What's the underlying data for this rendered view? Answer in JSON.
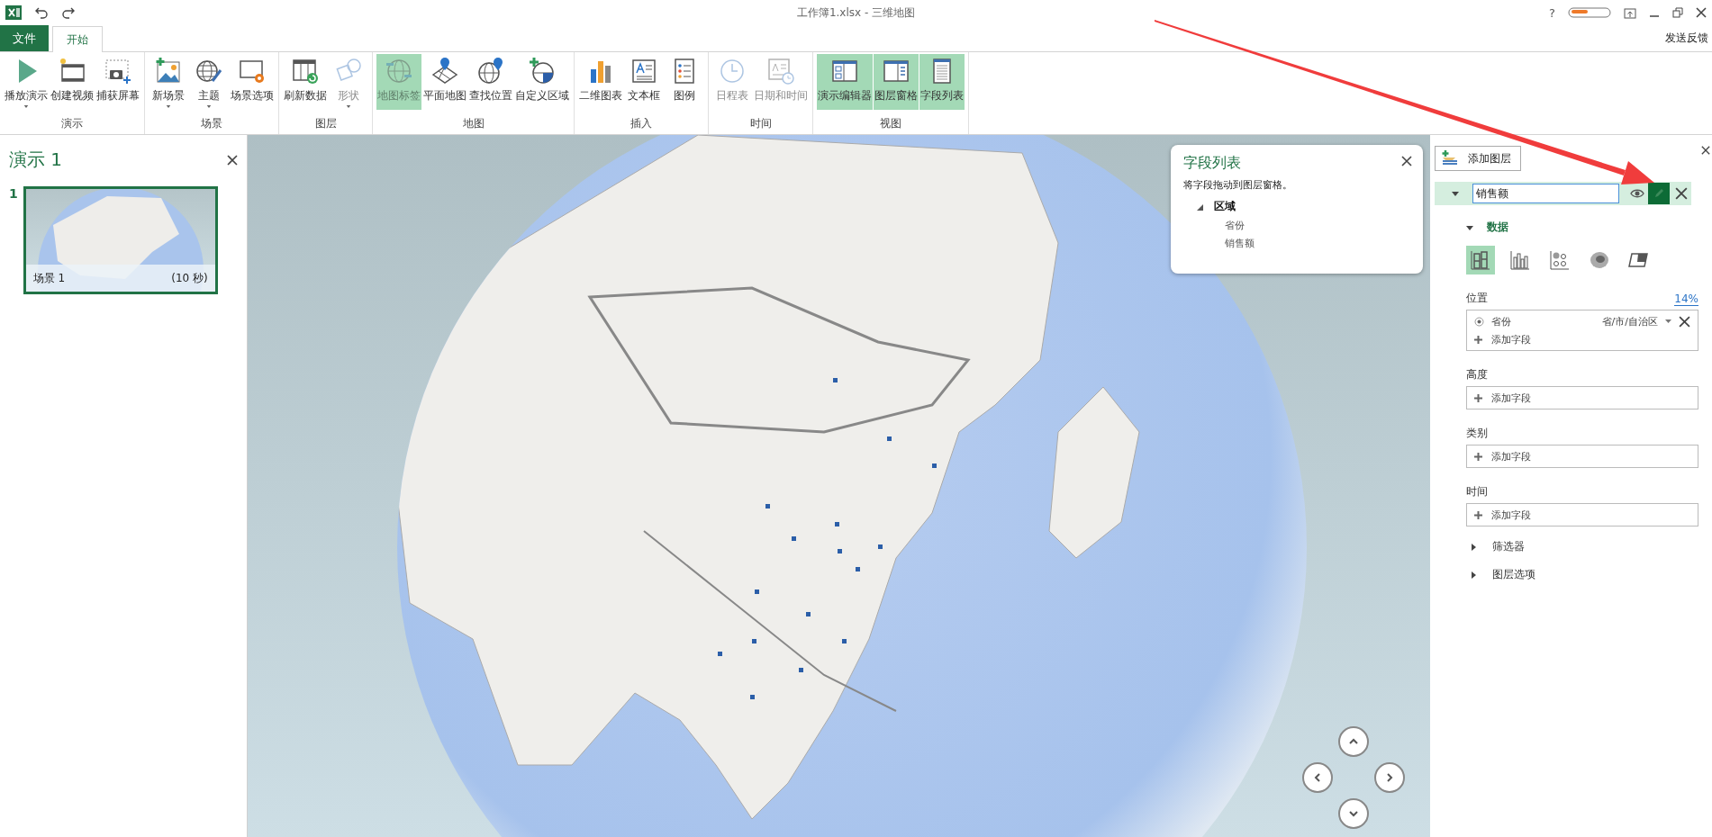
{
  "window": {
    "title": "工作簿1.xlsx - 三维地图",
    "help": "?"
  },
  "ribbon_tabs": [
    {
      "label": "文件",
      "kind": "file",
      "selected": false
    },
    {
      "label": "开始",
      "kind": "tab",
      "selected": true
    }
  ],
  "feedback": "发送反馈",
  "ribbon_groups": [
    {
      "label": "演示",
      "buttons": [
        {
          "label": "播放演示",
          "kind": "play",
          "dropdown": true,
          "selected": false,
          "disabled": false
        },
        {
          "label": "创建视频",
          "kind": "video",
          "dropdown": false,
          "selected": false,
          "disabled": false
        },
        {
          "label": "捕获屏幕",
          "kind": "capture",
          "dropdown": false,
          "selected": false,
          "disabled": false
        }
      ]
    },
    {
      "label": "场景",
      "buttons": [
        {
          "label": "新场景",
          "kind": "new-scene",
          "dropdown": true,
          "selected": false,
          "disabled": false
        },
        {
          "label": "主题",
          "kind": "theme",
          "dropdown": true,
          "selected": false,
          "disabled": false
        },
        {
          "label": "场景选项",
          "kind": "scene-options",
          "dropdown": false,
          "selected": false,
          "disabled": false
        }
      ]
    },
    {
      "label": "图层",
      "buttons": [
        {
          "label": "刷新数据",
          "kind": "refresh",
          "dropdown": false,
          "selected": false,
          "disabled": false
        },
        {
          "label": "形状",
          "kind": "shape",
          "dropdown": true,
          "selected": false,
          "disabled": true
        }
      ]
    },
    {
      "label": "地图",
      "buttons": [
        {
          "label": "地图标签",
          "kind": "map-labels",
          "dropdown": false,
          "selected": true,
          "disabled": true
        },
        {
          "label": "平面地图",
          "kind": "flat-map",
          "dropdown": false,
          "selected": false,
          "disabled": false
        },
        {
          "label": "查找位置",
          "kind": "find-location",
          "dropdown": false,
          "selected": false,
          "disabled": false
        },
        {
          "label": "自定义区域",
          "kind": "custom-regions",
          "dropdown": false,
          "selected": false,
          "disabled": false
        }
      ]
    },
    {
      "label": "插入",
      "buttons": [
        {
          "label": "二维图表",
          "kind": "chart-2d",
          "dropdown": false,
          "selected": false,
          "disabled": false
        },
        {
          "label": "文本框",
          "kind": "text-box",
          "dropdown": false,
          "selected": false,
          "disabled": false
        },
        {
          "label": "图例",
          "kind": "legend",
          "dropdown": false,
          "selected": false,
          "disabled": false
        }
      ]
    },
    {
      "label": "时间",
      "buttons": [
        {
          "label": "日程表",
          "kind": "timeline",
          "dropdown": false,
          "selected": false,
          "disabled": true
        },
        {
          "label": "日期和时间",
          "kind": "date-time",
          "dropdown": false,
          "selected": false,
          "disabled": true
        }
      ]
    },
    {
      "label": "视图",
      "buttons": [
        {
          "label": "演示编辑器",
          "kind": "tour-editor",
          "dropdown": false,
          "selected": true,
          "disabled": false
        },
        {
          "label": "图层窗格",
          "kind": "layer-pane",
          "dropdown": false,
          "selected": true,
          "disabled": false
        },
        {
          "label": "字段列表",
          "kind": "field-list",
          "dropdown": false,
          "selected": true,
          "disabled": false
        }
      ]
    }
  ],
  "tour_panel": {
    "title": "演示 1",
    "scenes": [
      {
        "number": "1",
        "name": "场景 1",
        "duration": "(10 秒)",
        "selected": true
      }
    ]
  },
  "field_list": {
    "title": "字段列表",
    "hint": "将字段拖动到图层窗格。",
    "tree": [
      {
        "label": "区域",
        "expanded": true,
        "children": [
          {
            "label": "省份"
          },
          {
            "label": "销售额"
          }
        ]
      }
    ]
  },
  "layer_pane": {
    "add_layer": "添加图层",
    "layer": {
      "name": "销售额",
      "expanded": true,
      "visible": true,
      "editing": true
    },
    "section": {
      "label": "数据",
      "expanded": true
    },
    "viz_types": [
      {
        "kind": "stacked-column",
        "selected": true
      },
      {
        "kind": "clustered-column",
        "selected": false
      },
      {
        "kind": "bubble",
        "selected": false
      },
      {
        "kind": "heat-map",
        "selected": false
      },
      {
        "kind": "region",
        "selected": false
      }
    ],
    "wells": [
      {
        "label": "位置",
        "link": "14%",
        "fields": [
          {
            "name": "省份",
            "type": "省/市/自治区"
          }
        ],
        "add": "添加字段"
      },
      {
        "label": "高度",
        "add": "添加字段"
      },
      {
        "label": "类别",
        "add": "添加字段"
      },
      {
        "label": "时间",
        "add": "添加字段"
      }
    ],
    "collapsed_sections": [
      {
        "label": "筛选器",
        "expanded": false
      },
      {
        "label": "图层选项",
        "expanded": false
      }
    ]
  }
}
